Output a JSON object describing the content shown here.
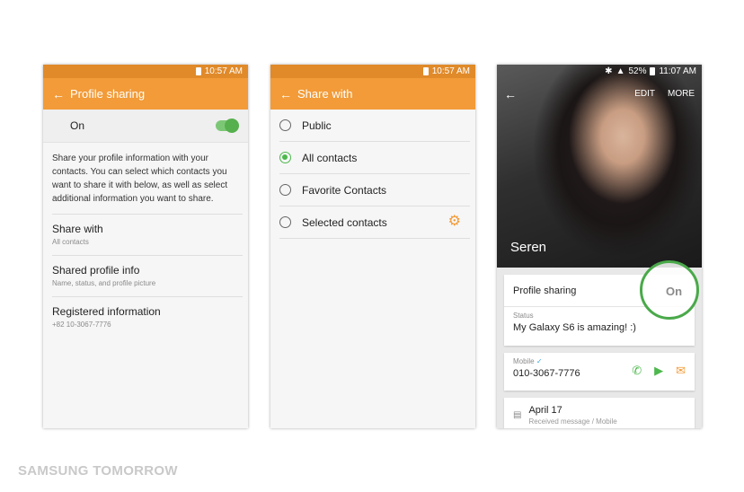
{
  "phone1": {
    "status_time": "10:57 AM",
    "title": "Profile sharing",
    "toggle_label": "On",
    "description": "Share your profile information with your contacts. You can select which contacts you want to share it with below, as well as select additional information you want to share.",
    "items": [
      {
        "title": "Share with",
        "subtitle": "All contacts"
      },
      {
        "title": "Shared profile info",
        "subtitle": "Name, status, and profile picture"
      },
      {
        "title": "Registered information",
        "subtitle": "+82 10-3067-7776"
      }
    ]
  },
  "phone2": {
    "status_time": "10:57 AM",
    "title": "Share with",
    "options": [
      "Public",
      "All contacts",
      "Favorite Contacts",
      "Selected contacts"
    ],
    "selected": "All contacts"
  },
  "phone3": {
    "status_battery": "52%",
    "status_time": "11:07 AM",
    "edit_label": "EDIT",
    "more_label": "MORE",
    "name": "Seren",
    "profile_sharing_label": "Profile sharing",
    "profile_sharing_value": "On",
    "status_label": "Status",
    "status_value": "My Galaxy S6 is amazing! :)",
    "mobile_label": "Mobile",
    "mobile_number": "010-3067-7776",
    "log_date": "April 17",
    "log_detail": "Received message / Mobile"
  },
  "footer": "SAMSUNG TOMORROW",
  "colors": {
    "accent": "#f29b38",
    "switch_on": "#56b04d",
    "highlight": "#4aa94a"
  }
}
